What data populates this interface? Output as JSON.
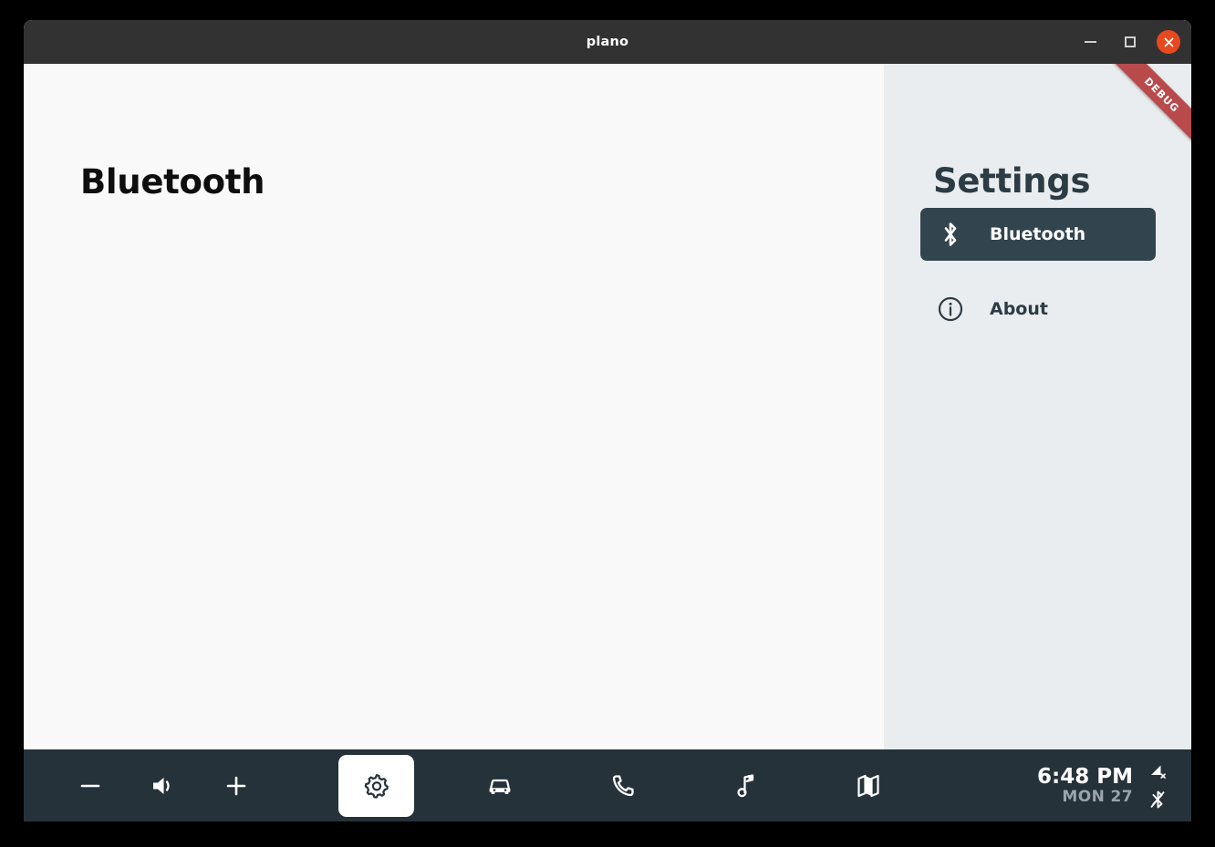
{
  "window": {
    "title": "plano",
    "controls": {
      "minimize_name": "minimize-button",
      "maximize_name": "maximize-button",
      "close_name": "close-button"
    }
  },
  "debug_ribbon": {
    "label": "DEBUG",
    "color": "#b94a4c"
  },
  "content": {
    "page_title": "Bluetooth",
    "background": "#f9f9f9"
  },
  "sidebar": {
    "title": "Settings",
    "background": "#eaedef",
    "selected_color": "#32444e",
    "items": [
      {
        "label": "Bluetooth",
        "icon": "bluetooth-icon",
        "selected": true
      },
      {
        "label": "About",
        "icon": "info-icon",
        "selected": false
      }
    ]
  },
  "toolbar": {
    "background": "#26323a",
    "volume": {
      "decrease_label": "−",
      "speaker_label": "volume-icon",
      "increase_label": "+"
    },
    "apps": [
      {
        "name": "settings",
        "icon": "gear-icon",
        "active": true
      },
      {
        "name": "car",
        "icon": "car-icon",
        "active": false
      },
      {
        "name": "phone",
        "icon": "phone-icon",
        "active": false
      },
      {
        "name": "music",
        "icon": "music-note-icon",
        "active": false
      },
      {
        "name": "maps",
        "icon": "map-icon",
        "active": false
      }
    ],
    "status": {
      "time": "6:48 PM",
      "date": "MON 27",
      "icons": [
        {
          "name": "cellular-signal-off-icon"
        },
        {
          "name": "bluetooth-off-icon"
        }
      ]
    }
  }
}
